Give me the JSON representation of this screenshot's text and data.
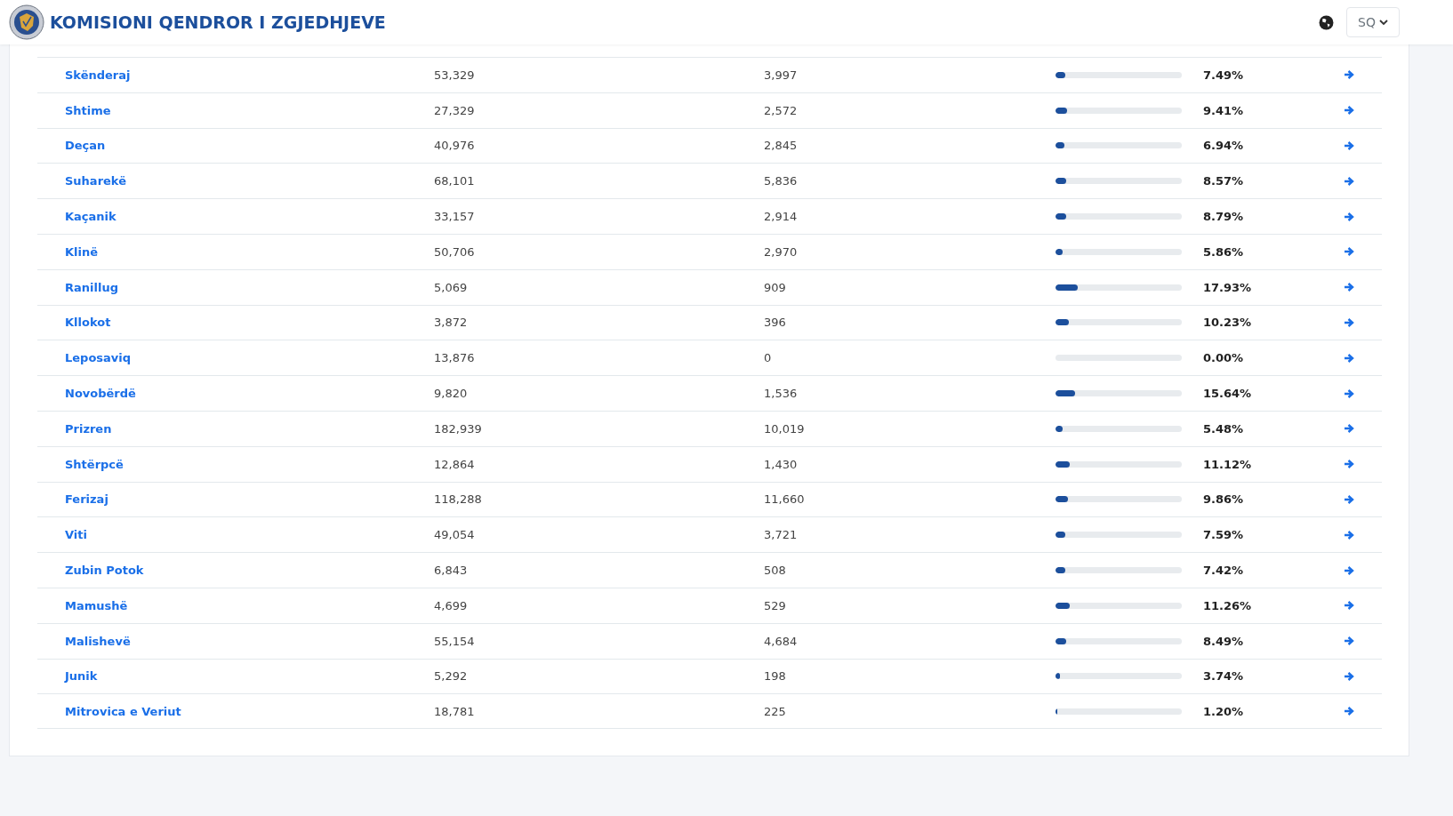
{
  "header": {
    "title": "KOMISIONI QENDROR I ZGJEDHJEVE",
    "language": "SQ"
  },
  "rows": [
    {
      "name": "Skënderaj",
      "column_2": "53,329",
      "column_3": "3,997",
      "level": 0.0749,
      "percent": "7.49%"
    },
    {
      "name": "Shtime",
      "column_2": "27,329",
      "column_3": "2,572",
      "level": 0.0941,
      "percent": "9.41%"
    },
    {
      "name": "Deçan",
      "column_2": "40,976",
      "column_3": "2,845",
      "level": 0.0694,
      "percent": "6.94%"
    },
    {
      "name": "Suharekë",
      "column_2": "68,101",
      "column_3": "5,836",
      "level": 0.0857,
      "percent": "8.57%"
    },
    {
      "name": "Kaçanik",
      "column_2": "33,157",
      "column_3": "2,914",
      "level": 0.0879,
      "percent": "8.79%"
    },
    {
      "name": "Klinë",
      "column_2": "50,706",
      "column_3": "2,970",
      "level": 0.0586,
      "percent": "5.86%"
    },
    {
      "name": "Ranillug",
      "column_2": "5,069",
      "column_3": "909",
      "level": 0.1793,
      "percent": "17.93%"
    },
    {
      "name": "Kllokot",
      "column_2": "3,872",
      "column_3": "396",
      "level": 0.1023,
      "percent": "10.23%"
    },
    {
      "name": "Leposaviq",
      "column_2": "13,876",
      "column_3": "0",
      "level": 0,
      "percent": "0.00%"
    },
    {
      "name": "Novobërdë",
      "column_2": "9,820",
      "column_3": "1,536",
      "level": 0.1564,
      "percent": "15.64%"
    },
    {
      "name": "Prizren",
      "column_2": "182,939",
      "column_3": "10,019",
      "level": 0.0548,
      "percent": "5.48%"
    },
    {
      "name": "Shtërpcë",
      "column_2": "12,864",
      "column_3": "1,430",
      "level": 0.1112,
      "percent": "11.12%"
    },
    {
      "name": "Ferizaj",
      "column_2": "118,288",
      "column_3": "11,660",
      "level": 0.0986,
      "percent": "9.86%"
    },
    {
      "name": "Viti",
      "column_2": "49,054",
      "column_3": "3,721",
      "level": 0.0759,
      "percent": "7.59%"
    },
    {
      "name": "Zubin Potok",
      "column_2": "6,843",
      "column_3": "508",
      "level": 0.0742,
      "percent": "7.42%"
    },
    {
      "name": "Mamushë",
      "column_2": "4,699",
      "column_3": "529",
      "level": 0.1126,
      "percent": "11.26%"
    },
    {
      "name": "Malishevë",
      "column_2": "55,154",
      "column_3": "4,684",
      "level": 0.0849,
      "percent": "8.49%"
    },
    {
      "name": "Junik",
      "column_2": "5,292",
      "column_3": "198",
      "level": 0.0374,
      "percent": "3.74%"
    },
    {
      "name": "Mitrovica e Veriut",
      "column_2": "18,781",
      "column_3": "225",
      "level": 0.012,
      "percent": "1.20%"
    }
  ]
}
